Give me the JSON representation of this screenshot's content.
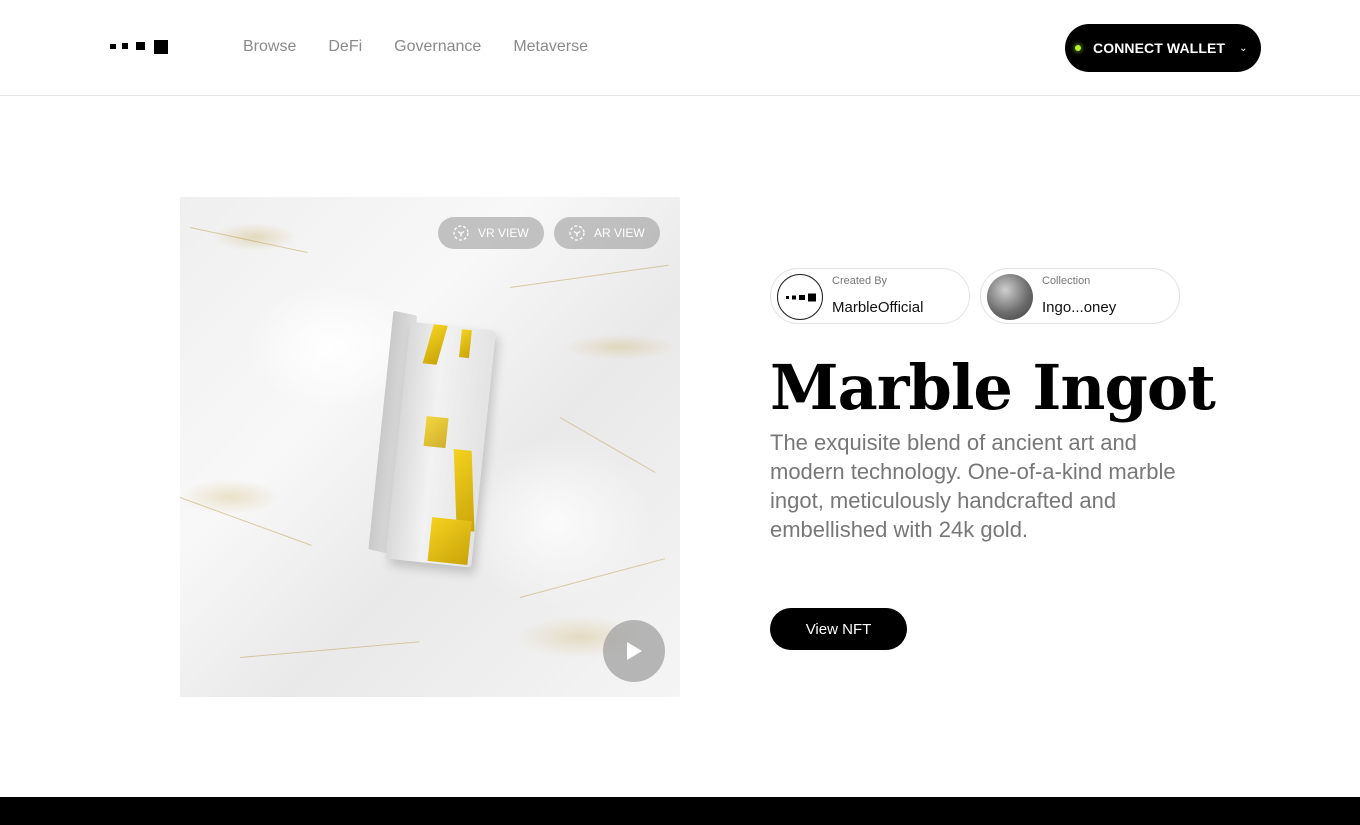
{
  "header": {
    "logo": "logo-icon",
    "nav": [
      "Browse",
      "DeFi",
      "Governance",
      "Metaverse"
    ],
    "wallet_label": "CONNECT WALLET",
    "wallet_status_color": "#b6f52a"
  },
  "media": {
    "vr_label": "VR VIEW",
    "ar_label": "AR VIEW",
    "icons": {
      "view": "cube-scan-icon",
      "play": "play-icon"
    }
  },
  "creator": {
    "caption": "Created By",
    "name": "MarbleOfficial"
  },
  "collection": {
    "caption": "Collection",
    "name": "Ingo...oney"
  },
  "nft": {
    "title": "Marble Ingot",
    "description": "The exquisite blend of ancient art and modern technology. One-of-a-kind marble ingot, meticulously handcrafted and embellished with 24k gold.",
    "cta": "View NFT"
  },
  "colors": {
    "primary": "#000000",
    "muted_text": "#777777",
    "nav_text": "#8a8a8a"
  }
}
